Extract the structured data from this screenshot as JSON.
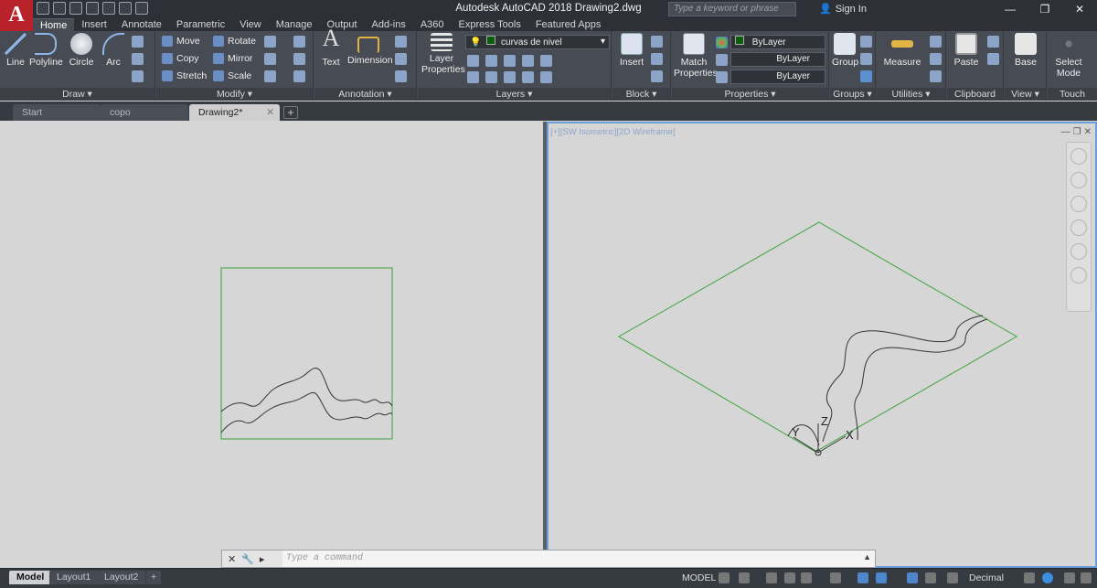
{
  "window": {
    "app_letter": "A",
    "title": "Autodesk AutoCAD 2018    Drawing2.dwg",
    "search_placeholder": "Type a keyword or phrase",
    "sign_in": "Sign In",
    "minimize": "—",
    "restore": "❐",
    "close": "✕"
  },
  "ribbon_tabs": [
    "Home",
    "Insert",
    "Annotate",
    "Parametric",
    "View",
    "Manage",
    "Output",
    "Add-ins",
    "A360",
    "Express Tools",
    "Featured Apps"
  ],
  "ribbon": {
    "draw": {
      "title": "Draw ▾",
      "line": "Line",
      "polyline": "Polyline",
      "circle": "Circle",
      "arc": "Arc"
    },
    "modify": {
      "title": "Modify ▾",
      "move": "Move",
      "rotate": "Rotate",
      "copy": "Copy",
      "mirror": "Mirror",
      "stretch": "Stretch",
      "scale": "Scale"
    },
    "annotation": {
      "title": "Annotation ▾",
      "text": "Text",
      "dimension": "Dimension"
    },
    "layers": {
      "title": "Layers ▾",
      "layer_properties_1": "Layer",
      "layer_properties_2": "Properties",
      "current_layer": "curvas de nivel"
    },
    "block": {
      "title": "Block ▾",
      "insert": "Insert"
    },
    "properties": {
      "title": "Properties ▾",
      "match_1": "Match",
      "match_2": "Properties",
      "color": "ByLayer",
      "linetype": "ByLayer",
      "lineweight": "ByLayer"
    },
    "groups": {
      "title": "Groups ▾",
      "group": "Group"
    },
    "utilities": {
      "title": "Utilities ▾",
      "measure": "Measure"
    },
    "clipboard": {
      "title": "Clipboard",
      "paste": "Paste"
    },
    "view": {
      "title": "View ▾",
      "base": "Base"
    },
    "touch": {
      "title": "Touch",
      "select_1": "Select",
      "select_2": "Mode"
    }
  },
  "doc_tabs": [
    "Start",
    "copo",
    "Drawing2*"
  ],
  "viewport_right_label": "[+][SW Isometric][2D Wireframe]",
  "ucs": {
    "x": "X",
    "y": "Y",
    "z": "Z"
  },
  "command": {
    "placeholder": "Type a command"
  },
  "layout_tabs": [
    "Model",
    "Layout1",
    "Layout2"
  ],
  "status": {
    "model": "MODEL",
    "units": "Decimal"
  },
  "colors": {
    "line_green": "#3aa33a",
    "accent": "#6aa0d8",
    "autocad_red": "#b8232b"
  }
}
